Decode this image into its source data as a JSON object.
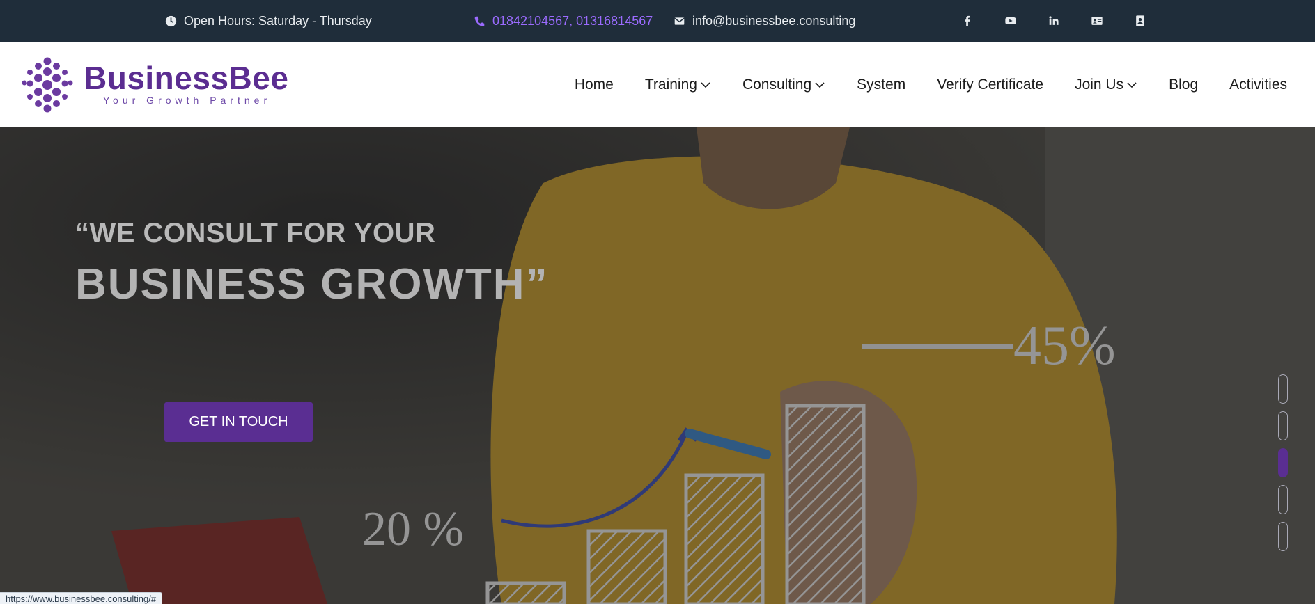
{
  "topbar": {
    "hours": "Open Hours: Saturday - Thursday",
    "phone": "01842104567, 01316814567",
    "email": "info@businessbee.consulting",
    "social_icons": [
      "facebook-icon",
      "youtube-icon",
      "linkedin-icon",
      "id-card-icon",
      "contact-book-icon"
    ]
  },
  "logo": {
    "name": "BusinessBee",
    "tagline": "Your Growth Partner"
  },
  "nav": {
    "home": "Home",
    "training": "Training",
    "consulting": "Consulting",
    "system": "System",
    "verify": "Verify Certificate",
    "join": "Join Us",
    "blog": "Blog",
    "activities": "Activities"
  },
  "hero": {
    "quote_line1": "“WE CONSULT FOR YOUR",
    "quote_line2": "BUSINESS GROWTH”",
    "cta": "GET IN TOUCH",
    "chart_low": "20 %",
    "chart_high": "45%",
    "slides": 5,
    "active_slide": 3
  },
  "status_url": "https://www.businessbee.consulting/#",
  "colors": {
    "topbar_bg": "#1f2d3a",
    "brand_purple": "#5a2e92",
    "phone_accent": "#9b6bff"
  }
}
